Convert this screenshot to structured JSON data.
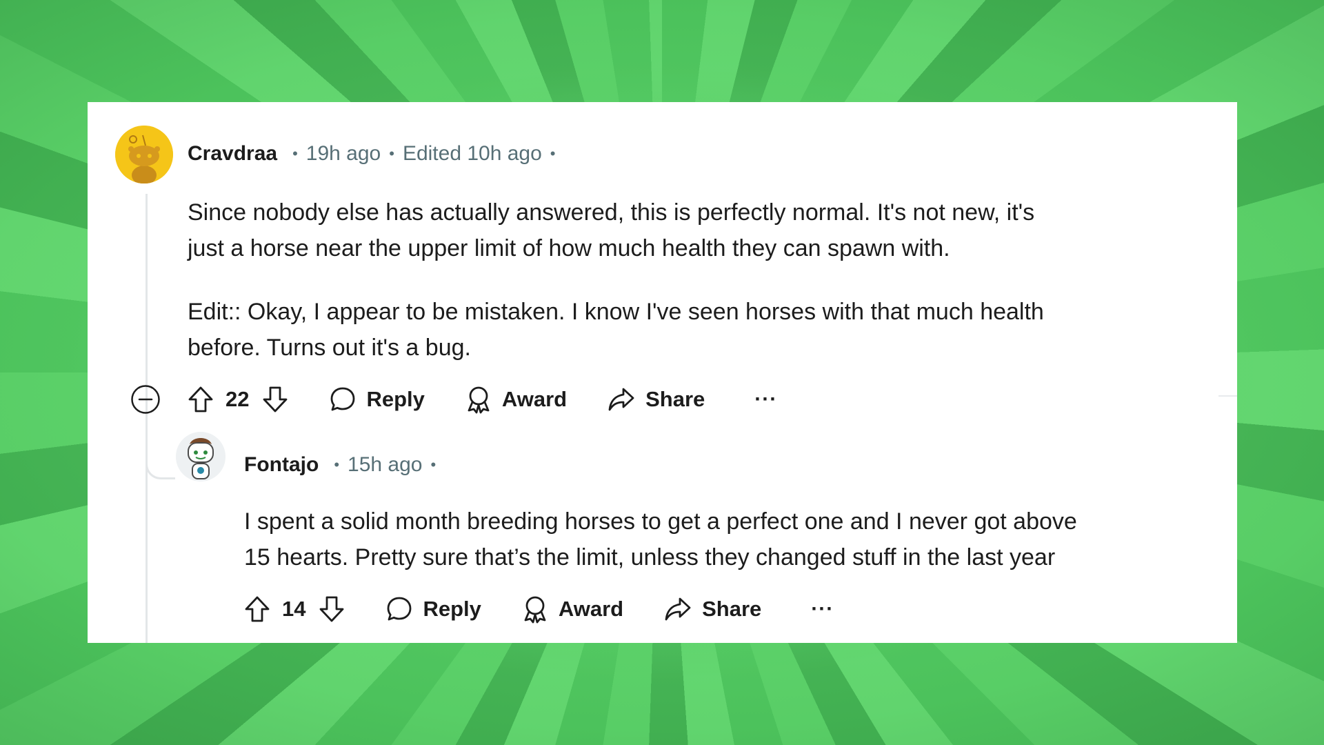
{
  "colors": {
    "background_green": "#5cd16a",
    "card": "#ffffff",
    "text_primary": "#1c1c1c",
    "text_meta": "#576f76",
    "thread_line": "#e3e6e8",
    "avatar_yellow": "#f5c518"
  },
  "comment": {
    "username": "Cravdraa",
    "time": "19h ago",
    "edited": "Edited 10h ago",
    "paragraphs": [
      "Since nobody else has actually answered, this is perfectly normal. It's not new, it's",
      "just a horse near the upper limit of how much health they can spawn with.",
      "Edit:: Okay, I appear to be mistaken.  I know I've seen horses with that much health",
      "before. Turns out it's a bug."
    ],
    "votes": "22",
    "actions": {
      "reply": "Reply",
      "award": "Award",
      "share": "Share",
      "more": "···"
    },
    "icons": {
      "avatar": "snoo-avatar-icon",
      "collapse": "collapse-minus-icon",
      "upvote": "upvote-arrow-icon",
      "downvote": "downvote-arrow-icon",
      "reply": "speech-bubble-icon",
      "award": "award-ribbon-icon",
      "share": "share-arrow-icon"
    }
  },
  "reply": {
    "username": "Fontajo",
    "time": "15h ago",
    "paragraphs": [
      "I spent a solid month breeding horses to get a perfect one and I never got above",
      "15 hearts. Pretty sure that’s the limit, unless they changed stuff in the last year"
    ],
    "votes": "14",
    "actions": {
      "reply": "Reply",
      "award": "Award",
      "share": "Share",
      "more": "···"
    }
  },
  "separator_dot": "•"
}
